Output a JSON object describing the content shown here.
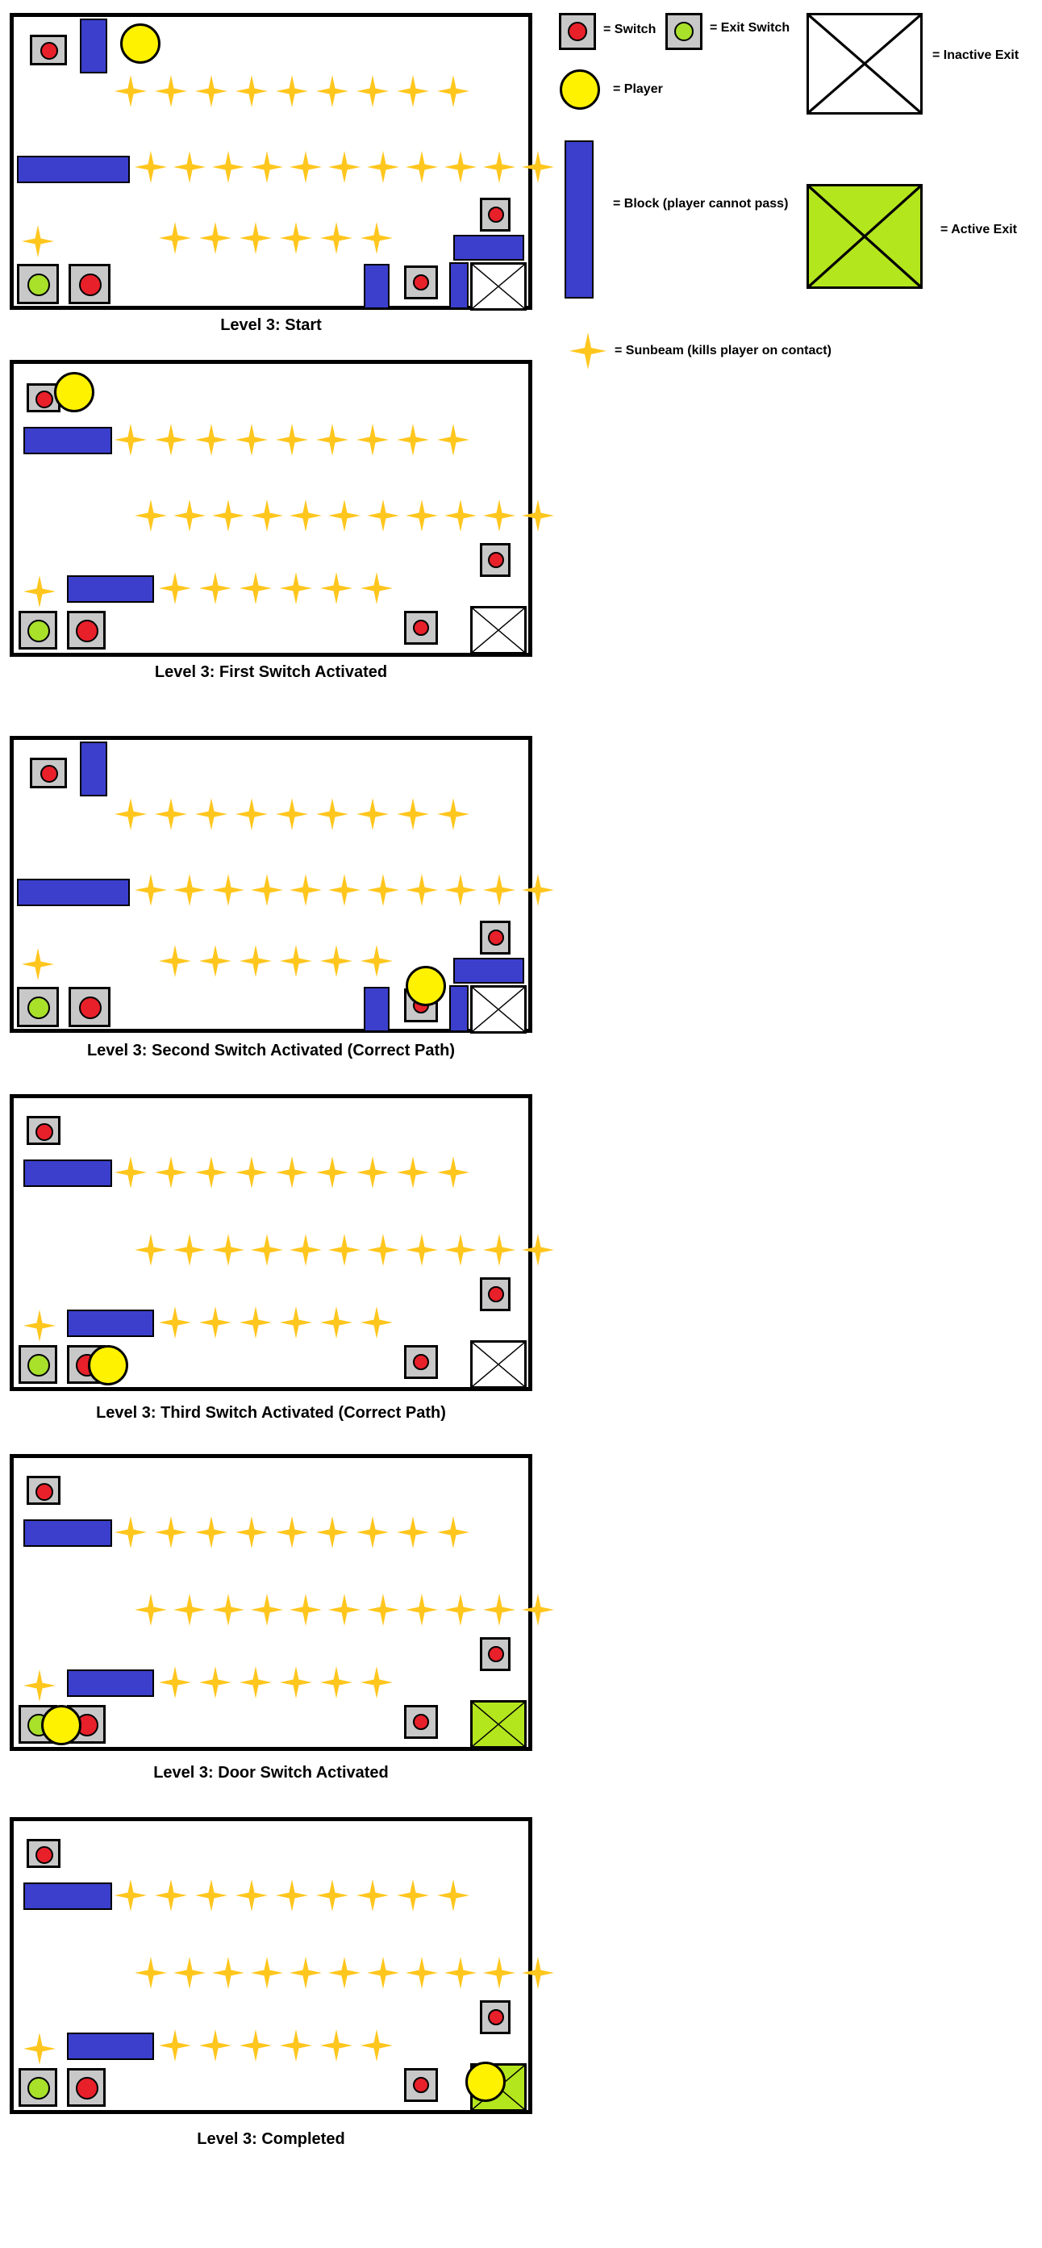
{
  "legend": {
    "switch": "= Switch",
    "exit_switch": "= Exit Switch",
    "inactive_exit": "= Inactive Exit",
    "player": "= Player",
    "block": "= Block (player cannot pass)",
    "active_exit": "= Active Exit",
    "sunbeam": "= Sunbeam (kills player on contact)"
  },
  "colors": {
    "block": "#3b3fcc",
    "switch_red": "#e8202a",
    "exit_switch_green": "#a8e02a",
    "player": "#fff200",
    "active_exit": "#b4e61e",
    "sunbeam": "#ffc61e",
    "switch_base": "#c8c8c8"
  },
  "panels": [
    {
      "caption": "Level 3: Start",
      "state": "start",
      "exit_active": false,
      "player_at": "top-left-block"
    },
    {
      "caption": "Level 3: First Switch Activated",
      "state": "first-switch",
      "exit_active": false,
      "player_at": "first-switch"
    },
    {
      "caption": "Level 3: Second Switch Activated (Correct Path)",
      "state": "second-switch",
      "exit_active": false,
      "player_at": "second-switch"
    },
    {
      "caption": "Level 3: Third Switch Activated (Correct Path)",
      "state": "third-switch",
      "exit_active": false,
      "player_at": "third-switch"
    },
    {
      "caption": "Level 3: Door Switch Activated",
      "state": "door-switch",
      "exit_active": true,
      "player_at": "exit-switch"
    },
    {
      "caption": "Level 3: Completed",
      "state": "completed",
      "exit_active": true,
      "player_at": "exit"
    }
  ]
}
